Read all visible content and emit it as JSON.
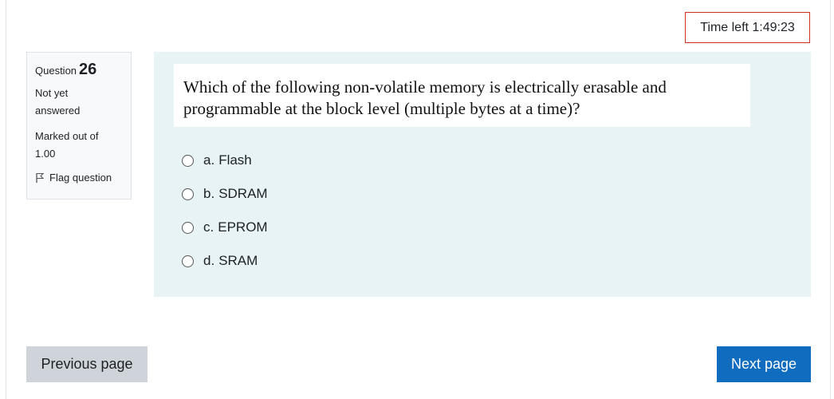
{
  "timer": {
    "label": "Time left 1:49:23"
  },
  "info": {
    "question_label": "Question",
    "question_number": "26",
    "state_line1": "Not yet",
    "state_line2": "answered",
    "grade_line1": "Marked out of",
    "grade_line2": "1.00",
    "flag_label": "Flag question"
  },
  "question": {
    "text": "Which of the following non-volatile memory is electrically erasable and programmable at the block level (multiple bytes at a time)?",
    "options": [
      {
        "letter": "a.",
        "text": "Flash"
      },
      {
        "letter": "b.",
        "text": "SDRAM"
      },
      {
        "letter": "c.",
        "text": "EPROM"
      },
      {
        "letter": "d.",
        "text": "SRAM"
      }
    ]
  },
  "navigation": {
    "previous_label": "Previous page",
    "next_label": "Next page"
  },
  "colors": {
    "timer_border": "#ca3120",
    "question_background": "#e7f3f5",
    "next_button": "#0f6cbf",
    "previous_button": "#ced4da"
  },
  "icons": {
    "flag": "flag-outline-icon",
    "radio": "radio-unchecked-icon"
  }
}
